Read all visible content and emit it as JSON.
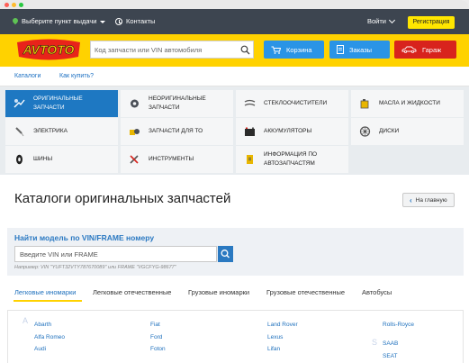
{
  "topbar": {
    "pickup_label": "Выберите пункт выдачи",
    "contacts_label": "Контакты",
    "login_label": "Войти",
    "register_label": "Регистрация"
  },
  "header": {
    "logo_text": "AVTOTO",
    "search_placeholder": "Код запчасти или VIN автомобиля",
    "cart_label": "Корзина",
    "orders_label": "Заказы",
    "garage_label": "Гараж"
  },
  "subnav": {
    "catalogs_label": "Каталоги",
    "how_to_buy_label": "Как купить?"
  },
  "categories": [
    {
      "label": "Оригинальные запчасти",
      "icon": "original-parts-icon",
      "active": true
    },
    {
      "label": "Неоригинальные запчасти",
      "icon": "aftermarket-parts-icon",
      "active": false
    },
    {
      "label": "Стеклоочистители",
      "icon": "wiper-icon",
      "active": false
    },
    {
      "label": "Масла и жидкости",
      "icon": "oil-icon",
      "active": false
    },
    {
      "label": "Электрика",
      "icon": "spark-plug-icon",
      "active": false
    },
    {
      "label": "Запчасти для ТО",
      "icon": "maintenance-parts-icon",
      "active": false
    },
    {
      "label": "Аккумуляторы",
      "icon": "battery-icon",
      "active": false
    },
    {
      "label": "Диски",
      "icon": "wheel-rim-icon",
      "active": false
    },
    {
      "label": "Шины",
      "icon": "tire-icon",
      "active": false
    },
    {
      "label": "Инструменты",
      "icon": "tools-icon",
      "active": false
    },
    {
      "label": "Информация по автозапчастям",
      "icon": "info-icon",
      "active": false
    }
  ],
  "page": {
    "title": "Каталоги оригинальных запчастей",
    "back_label": "На главную"
  },
  "vin": {
    "title": "Найти модель по VIN/FRAME номеру",
    "placeholder": "Введите VIN или FRAME",
    "hint": "Например: VIN \"YUFT32VTY787670089\" или FRAME \"VGCFYG-98677\""
  },
  "tabs": [
    {
      "label": "Легковые иномарки",
      "active": true
    },
    {
      "label": "Легковые отечественные",
      "active": false
    },
    {
      "label": "Грузовые иномарки",
      "active": false
    },
    {
      "label": "Грузовые отечественные",
      "active": false
    },
    {
      "label": "Автобусы",
      "active": false
    }
  ],
  "brands": {
    "letter_a": "A",
    "letter_s": "S",
    "col1": [
      "Abarth",
      "Alfa Romeo",
      "Audi"
    ],
    "col2": [
      "Fiat",
      "Ford",
      "Foton"
    ],
    "col3": [
      "Land Rover",
      "Lexus",
      "Lifan"
    ],
    "col4": [
      "Rolls-Royce",
      "SAAB",
      "SEAT"
    ]
  },
  "colors": {
    "brand_yellow": "#ffd200",
    "topbar": "#3d4550",
    "accent_blue": "#1e78c2",
    "garage_red": "#d8231d"
  }
}
